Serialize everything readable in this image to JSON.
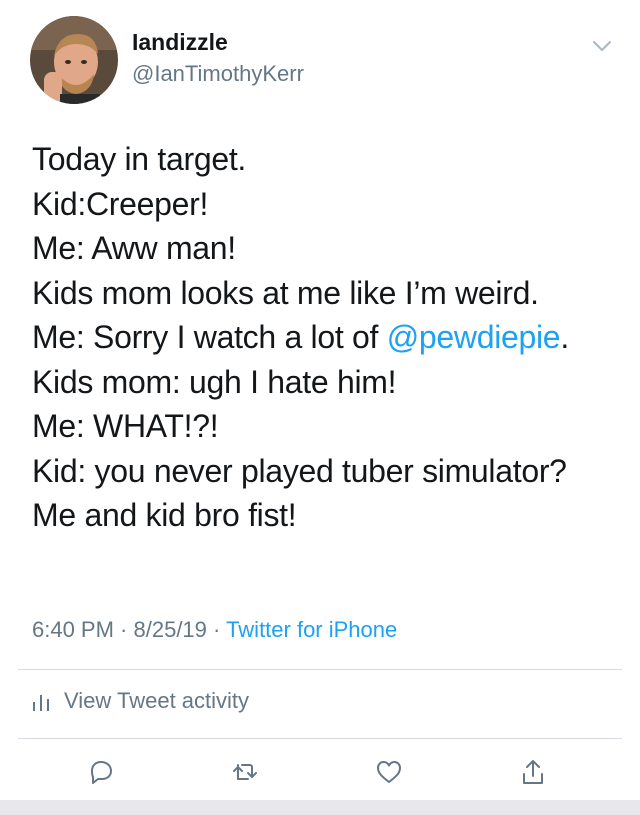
{
  "user": {
    "display_name": "Iandizzle",
    "handle": "@IanTimothyKerr"
  },
  "tweet": {
    "lines": [
      [
        "Today in target.",
        ""
      ],
      [
        "Kid:Creeper!",
        ""
      ],
      [
        "Me: Aww man!",
        ""
      ],
      [
        "Kids mom looks at me like I’m weird.",
        ""
      ],
      [
        "Me: Sorry I watch a lot of ",
        "@pewdiepie",
        "."
      ],
      [
        "Kids mom: ugh I hate him!",
        ""
      ],
      [
        "Me: WHAT!?!",
        ""
      ],
      [
        "Kid: you never played tuber simulator?",
        ""
      ],
      [
        "Me and kid bro fist!",
        ""
      ]
    ],
    "line5_prefix": "Me: Sorry I watch a lot of ",
    "line5_mention": "@pewdiepie",
    "line5_suffix": "."
  },
  "meta": {
    "time": "6:40 PM",
    "separator": " · ",
    "date": "8/25/19",
    "separator2": " · ",
    "source": "Twitter for iPhone"
  },
  "activity": {
    "label": "View Tweet activity"
  },
  "icons": {
    "more": "chevron-down-icon",
    "activity": "bar-chart-icon",
    "reply": "reply-icon",
    "retweet": "retweet-icon",
    "like": "heart-icon",
    "share": "share-icon"
  },
  "colors": {
    "text": "#14171a",
    "muted": "#657786",
    "link": "#1da1f2",
    "divider": "#d9dde1"
  }
}
